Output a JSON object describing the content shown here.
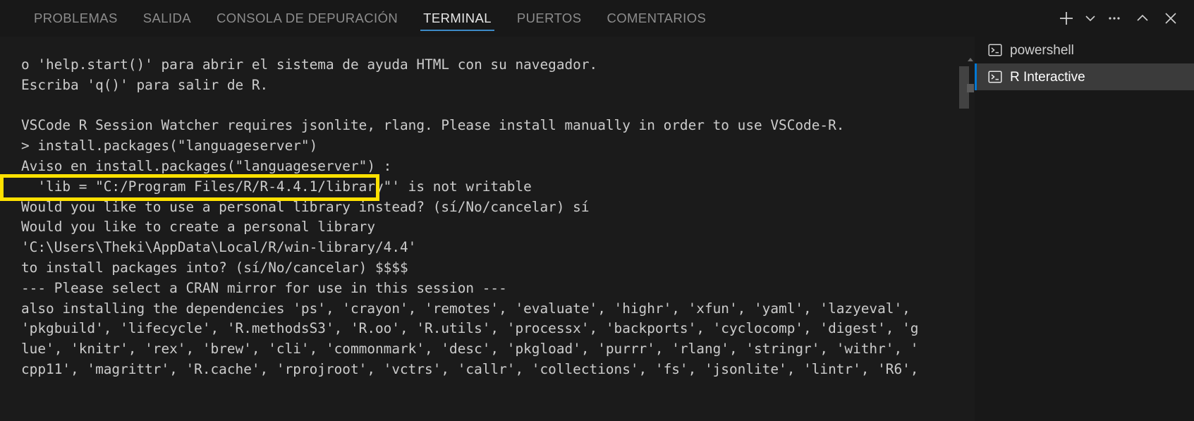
{
  "panel": {
    "tabs": [
      {
        "label": "PROBLEMAS",
        "active": false
      },
      {
        "label": "SALIDA",
        "active": false
      },
      {
        "label": "CONSOLA DE DEPURACIÓN",
        "active": false
      },
      {
        "label": "TERMINAL",
        "active": true
      },
      {
        "label": "PUERTOS",
        "active": false
      },
      {
        "label": "COMENTARIOS",
        "active": false
      }
    ],
    "actions": [
      {
        "name": "new-terminal-button",
        "icon": "plus-icon"
      },
      {
        "name": "terminal-profile-dropdown-button",
        "icon": "chevron-down-icon"
      },
      {
        "name": "panel-more-actions-button",
        "icon": "ellipsis-icon"
      },
      {
        "name": "maximize-panel-button",
        "icon": "chevron-up-icon"
      },
      {
        "name": "close-panel-button",
        "icon": "close-icon"
      }
    ]
  },
  "terminal": {
    "lines": [
      "o 'help.start()' para abrir el sistema de ayuda HTML con su navegador.",
      "Escriba 'q()' para salir de R.",
      "",
      "VSCode R Session Watcher requires jsonlite, rlang. Please install manually in order to use VSCode-R.",
      "> install.packages(\"languageserver\")",
      "Aviso en install.packages(\"languageserver\") :",
      "  'lib = \"C:/Program Files/R/R-4.4.1/library\"' is not writable",
      "Would you like to use a personal library instead? (sí/No/cancelar) sí",
      "Would you like to create a personal library",
      "'C:\\Users\\Theki\\AppData\\Local/R/win-library/4.4'",
      "to install packages into? (sí/No/cancelar) $$$$",
      "--- Please select a CRAN mirror for use in this session ---",
      "also installing the dependencies 'ps', 'crayon', 'remotes', 'evaluate', 'highr', 'xfun', 'yaml', 'lazyeval',",
      "'pkgbuild', 'lifecycle', 'R.methodsS3', 'R.oo', 'R.utils', 'processx', 'backports', 'cyclocomp', 'digest', 'g",
      "lue', 'knitr', 'rex', 'brew', 'cli', 'commonmark', 'desc', 'pkgload', 'purrr', 'rlang', 'stringr', 'withr', '",
      "cpp11', 'magrittr', 'R.cache', 'rprojroot', 'vctrs', 'callr', 'collections', 'fs', 'jsonlite', 'lintr', 'R6',"
    ],
    "prompt_command": "> install.packages(\"languageserver\")",
    "annotation_color": "#ffe100"
  },
  "terminal_list": {
    "items": [
      {
        "label": "powershell",
        "icon": "terminal-icon",
        "selected": false
      },
      {
        "label": "R Interactive",
        "icon": "terminal-icon",
        "selected": true
      }
    ]
  },
  "colors": {
    "accent": "#3d8ac7",
    "selected_indicator": "#0078d4",
    "panel_background": "#181818",
    "terminal_background": "#1b1b1b",
    "text": "#cccccc",
    "highlight": "#ffe100"
  }
}
